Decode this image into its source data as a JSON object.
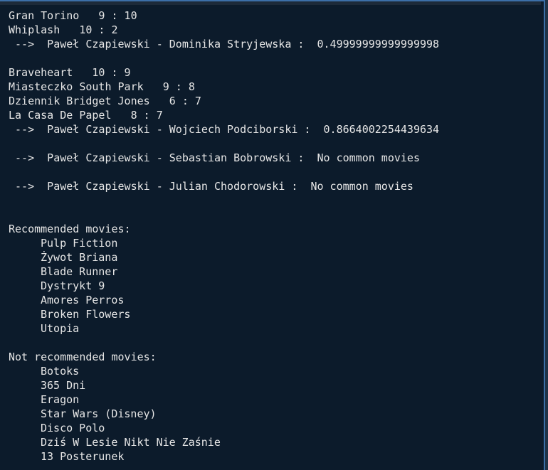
{
  "terminal": {
    "lines_group_1": [
      "Gran Torino   9 : 10",
      "Whiplash   10 : 2"
    ],
    "arrow_1": " -->  Paweł Czapiewski - Dominika Stryjewska :  0.49999999999999998",
    "lines_group_2": [
      "Braveheart   10 : 9",
      "Miasteczko South Park   9 : 8",
      "Dziennik Bridget Jones   6 : 7",
      "La Casa De Papel   8 : 7"
    ],
    "arrow_2": " -->  Paweł Czapiewski - Wojciech Podciborski :  0.8664002254439634",
    "arrow_3": " -->  Paweł Czapiewski - Sebastian Bobrowski :  No common movies",
    "arrow_4": " -->  Paweł Czapiewski - Julian Chodorowski :  No common movies",
    "recommended_heading": "Recommended movies:",
    "recommended": [
      "Pulp Fiction",
      "Żywot Briana",
      "Blade Runner",
      "Dystrykt 9",
      "Amores Perros",
      "Broken Flowers",
      "Utopia"
    ],
    "not_recommended_heading": "Not recommended movies:",
    "not_recommended": [
      "Botoks",
      "365 Dni",
      "Eragon",
      "Star Wars (Disney)",
      "Disco Polo",
      "Dziś W Lesie Nikt Nie Zaśnie",
      "13 Posterunek"
    ]
  },
  "colors": {
    "background": "#0c1b2b",
    "text": "#e6e6e6",
    "frame": "#3c6fa8"
  }
}
